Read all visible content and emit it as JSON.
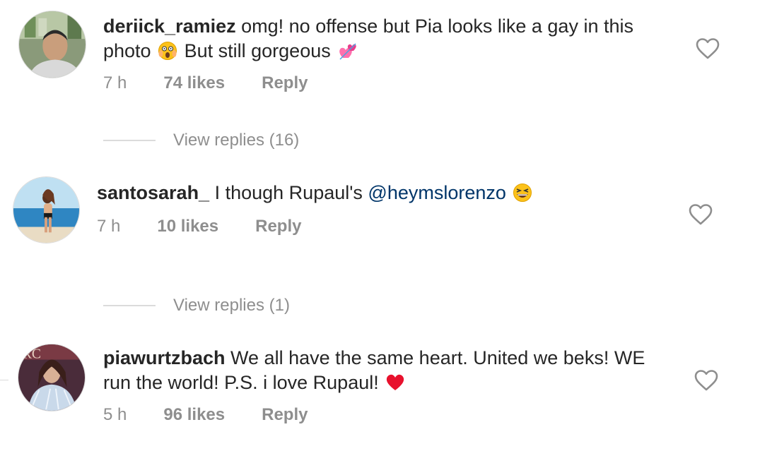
{
  "comments": [
    {
      "username": "deriick_ramiez",
      "text_line1": "omg! no offense but Pia looks like a gay in this",
      "text_line2_a": "photo",
      "text_line2_b": "But still gorgeous",
      "time": "7 h",
      "likes": "74 likes",
      "reply": "Reply",
      "view_replies": "View replies (16)"
    },
    {
      "username": "santosarah_",
      "text_a": "I though Rupaul's",
      "mention": "@heymslorenzo",
      "time": "7 h",
      "likes": "10 likes",
      "reply": "Reply",
      "view_replies": "View replies (1)"
    },
    {
      "username": "piawurtzbach",
      "text_line1": "We all have the same heart. United we beks! WE",
      "text_line2": "run the world! P.S. i love Rupaul!",
      "time": "5 h",
      "likes": "96 likes",
      "reply": "Reply"
    }
  ],
  "icons": {
    "like": "heart-outline-icon",
    "emoji_shocked": "shocked-face-emoji",
    "emoji_hearts": "two-hearts-emoji",
    "emoji_laughing": "grinning-squint-emoji",
    "emoji_heart": "red-heart-emoji"
  },
  "colors": {
    "text": "#262626",
    "muted": "#8e8e8e",
    "mention": "#003569",
    "divider": "#dbdbdb",
    "heart_red": "#ed4956"
  }
}
